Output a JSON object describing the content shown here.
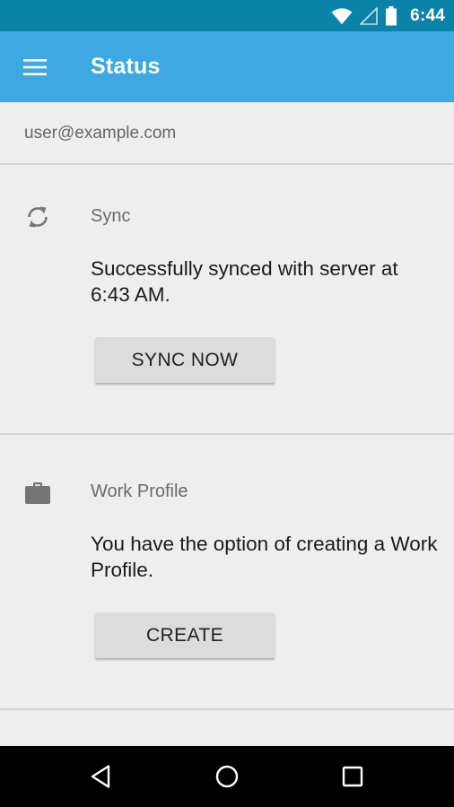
{
  "status_bar": {
    "time": "6:44",
    "icons": [
      "wifi-icon",
      "cell-signal-icon",
      "battery-icon"
    ]
  },
  "app_bar": {
    "menu_icon": "hamburger-menu-icon",
    "title": "Status"
  },
  "account": {
    "email": "user@example.com"
  },
  "sync": {
    "icon": "sync-icon",
    "heading": "Sync",
    "message": "Successfully synced with server at 6:43 AM.",
    "button_label": "SYNC NOW"
  },
  "work_profile": {
    "icon": "briefcase-icon",
    "heading": "Work Profile",
    "message": "You have the option of creating a Work Profile.",
    "button_label": "CREATE"
  },
  "nav_bar": {
    "buttons": [
      "back-icon",
      "home-icon",
      "recents-icon"
    ]
  },
  "colors": {
    "status_bar": "#0b83a8",
    "app_bar": "#3da8e1",
    "background": "#eeeeee",
    "button": "#dcdcdc"
  }
}
